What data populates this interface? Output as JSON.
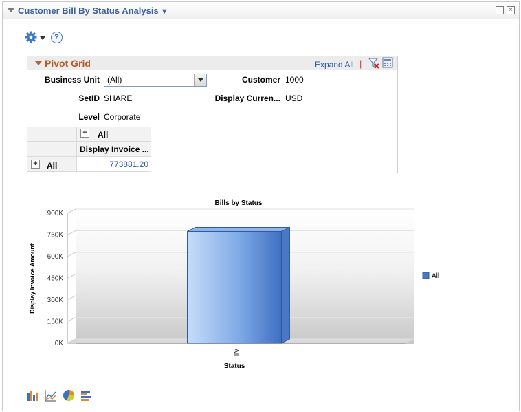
{
  "panel": {
    "title": "Customer Bill By Status Analysis",
    "title_caret": "▼",
    "maximize_label": "",
    "close_label": "×"
  },
  "toolbar": {
    "options_icon": "gear-icon",
    "help_label": "?"
  },
  "pivot": {
    "title": "Pivot Grid",
    "expand_all": "Expand All",
    "separator": "|",
    "prompts": {
      "business_unit_label": "Business Unit",
      "business_unit_value": "(All)",
      "customer_label": "Customer",
      "customer_value": "1000",
      "setid_label": "SetID",
      "setid_value": "SHARE",
      "display_currency_label": "Display Curren...",
      "display_currency_value": "USD",
      "level_label": "Level",
      "level_value": "Corporate"
    },
    "grid": {
      "col_header": "All",
      "col_field": "Display Invoice ...",
      "row_header": "All",
      "cell_value": "773881.20"
    }
  },
  "chart_data": {
    "type": "bar",
    "title": "Bills by Status",
    "xlabel": "Status",
    "ylabel": "Display Invoice Amount",
    "categories": [
      "All"
    ],
    "series": [
      {
        "name": "All",
        "values": [
          773881.2
        ]
      }
    ],
    "yticks": [
      "0K",
      "150K",
      "300K",
      "450K",
      "600K",
      "750K",
      "900K"
    ],
    "ylim": [
      0,
      900000
    ],
    "legend_position": "right",
    "colors": {
      "bar": "#5b8fd8",
      "bar_light": "#bcd4f7"
    }
  },
  "chart_type_icons": [
    "bar-chart-icon",
    "line-chart-icon",
    "pie-chart-icon",
    "horizontal-bar-chart-icon"
  ]
}
